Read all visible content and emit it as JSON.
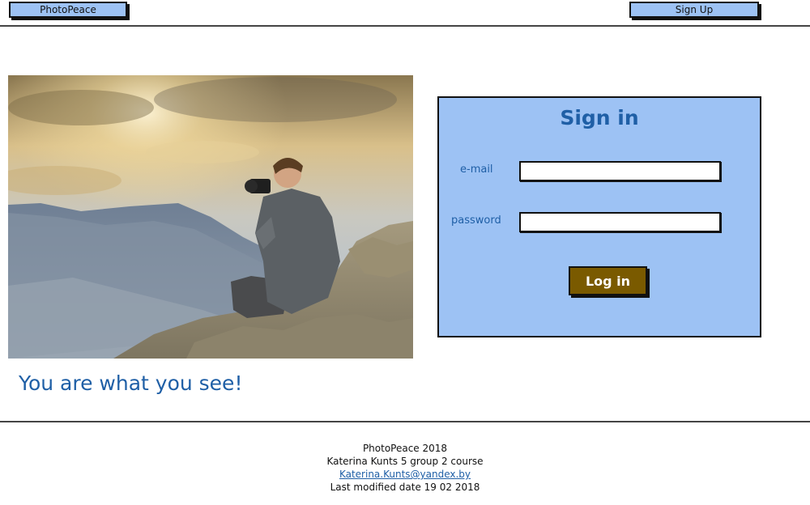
{
  "header": {
    "brand_label": "PhotoPeace",
    "signup_label": "Sign Up"
  },
  "hero": {
    "tagline": "You are what you see!"
  },
  "signin": {
    "title": "Sign in",
    "email_label": "e-mail",
    "email_value": "",
    "password_label": "password",
    "password_value": "",
    "login_label": "Log in"
  },
  "footer": {
    "line1": "PhotoPeace 2018",
    "line2": "Katerina Kunts 5 group 2 course",
    "email_link": "Katerina.Kunts@yandex.by",
    "line4": "Last modified date 19 02 2018"
  },
  "colors": {
    "accent_blue": "#9dc2f4",
    "heading_blue": "#1f5fa6",
    "login_brown": "#7a5a00"
  }
}
